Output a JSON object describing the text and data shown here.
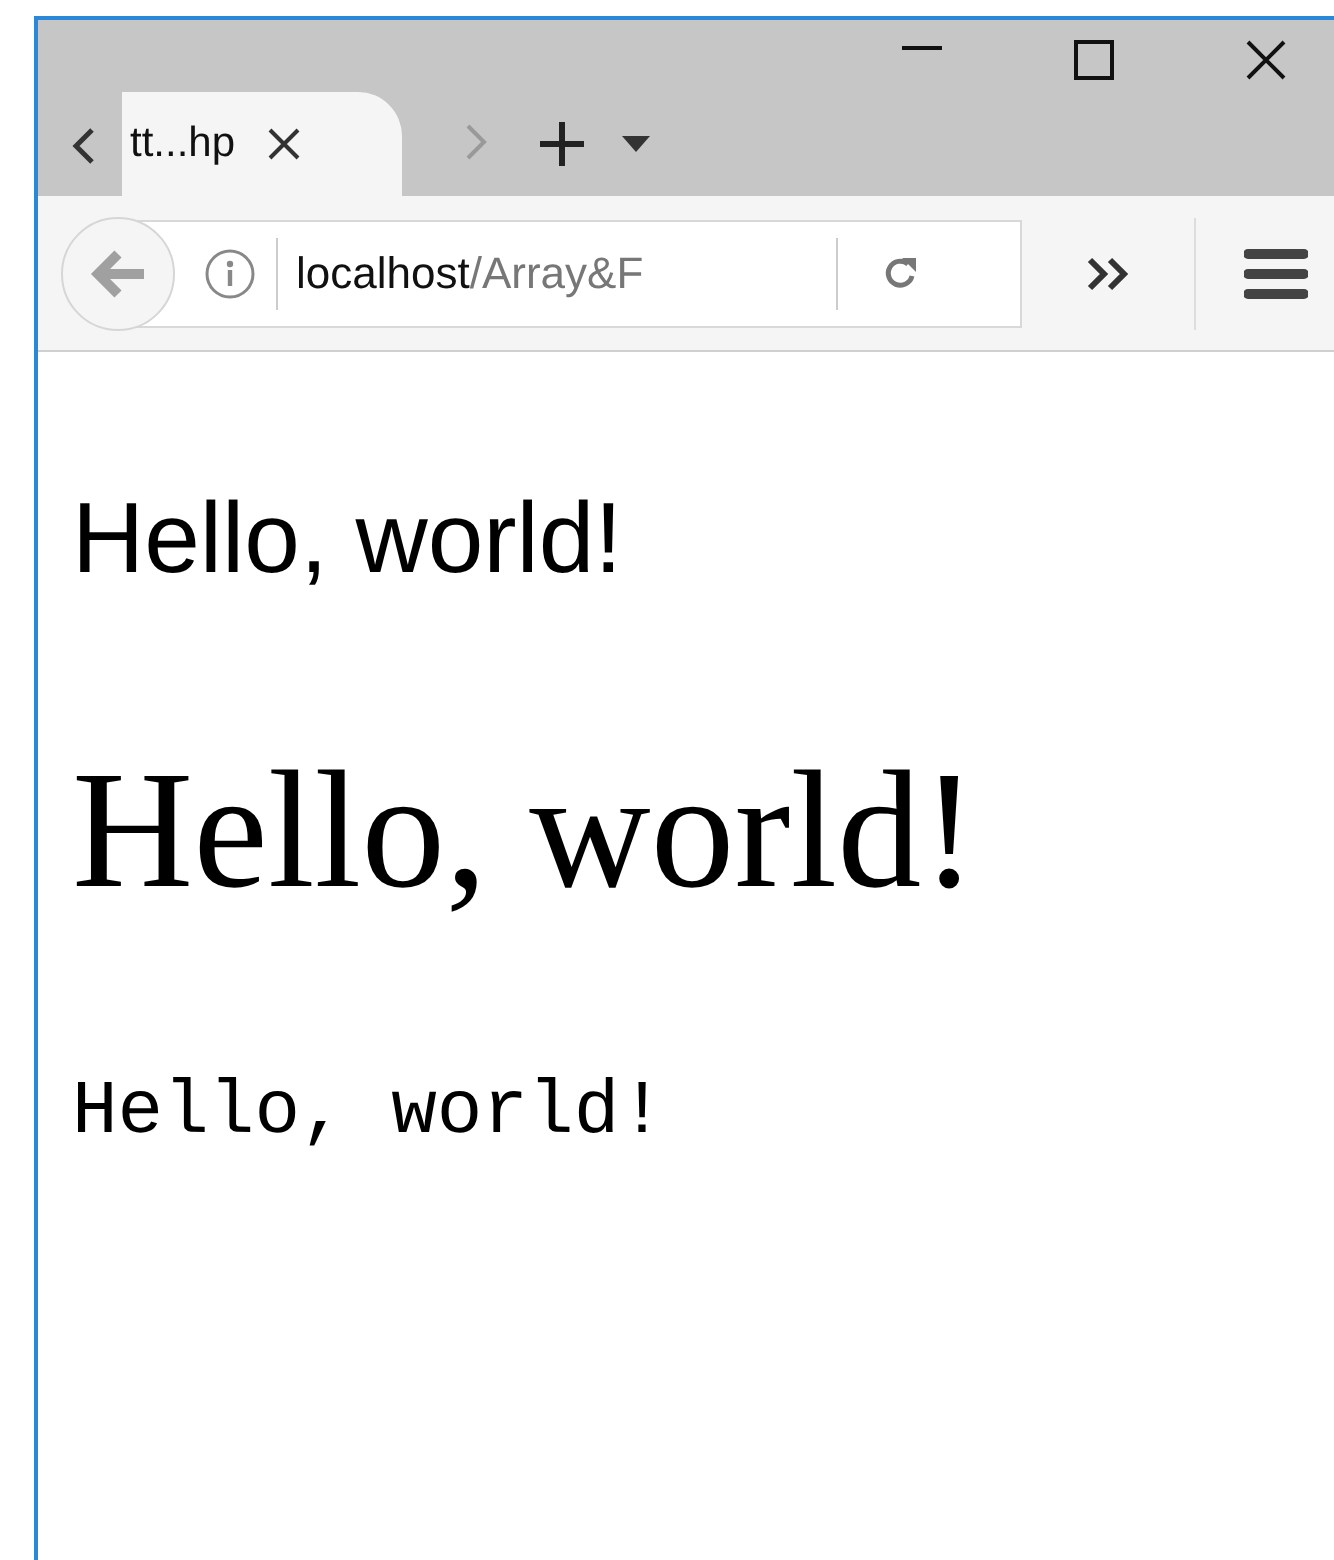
{
  "tabs": [
    {
      "title": "tt...hp",
      "selected": true
    }
  ],
  "address_bar": {
    "host": "localhost",
    "path": "/Array&F"
  },
  "content": [
    {
      "kind": "sans",
      "text": "Hello, world!"
    },
    {
      "kind": "serif",
      "text": "Hello, world!"
    },
    {
      "kind": "mono",
      "text": "Hello, world!"
    }
  ]
}
